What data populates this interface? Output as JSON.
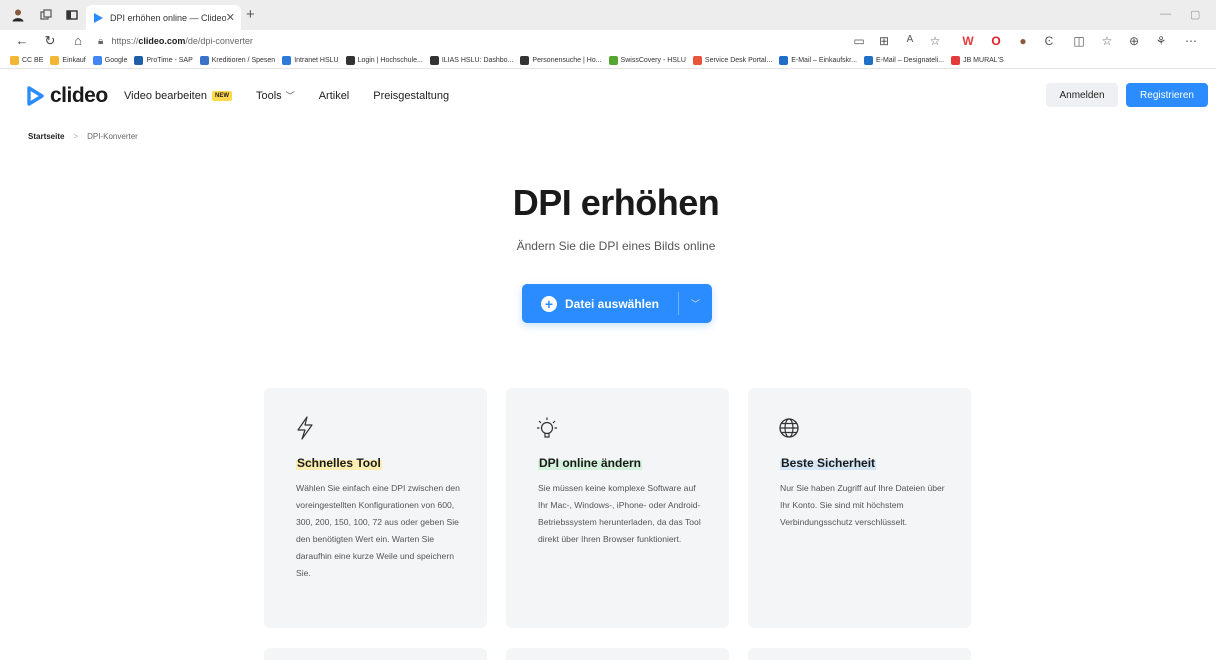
{
  "browser": {
    "tab_title": "DPI erhöhen online — Clideo",
    "url_prefix": "https://",
    "url_domain": "clideo.com",
    "url_path": "/de/dpi-converter",
    "bookmarks": [
      {
        "label": "CC BE",
        "color": "#f2b632"
      },
      {
        "label": "Einkauf",
        "color": "#f2b632"
      },
      {
        "label": "Google",
        "color": "#4285f4"
      },
      {
        "label": "ProTime - SAP",
        "color": "#1e5fa8"
      },
      {
        "label": "Kreditioren / Spesen",
        "color": "#3a72c8"
      },
      {
        "label": "Intranet HSLU",
        "color": "#2f7ad6"
      },
      {
        "label": "Login | Hochschule...",
        "color": "#333333"
      },
      {
        "label": "ILIAS HSLU: Dashbo...",
        "color": "#333333"
      },
      {
        "label": "Personensuche | Ho...",
        "color": "#333333"
      },
      {
        "label": "SwissCovery - HSLU",
        "color": "#55a630"
      },
      {
        "label": "Service Desk Portal...",
        "color": "#e8553a"
      },
      {
        "label": "E-Mail – Einkaufskr...",
        "color": "#1f6fc6"
      },
      {
        "label": "E-Mail – Designateli...",
        "color": "#1f6fc6"
      },
      {
        "label": "JB MURAL'S",
        "color": "#e33b3b"
      }
    ]
  },
  "header": {
    "logo": "clideo",
    "nav": {
      "video": "Video bearbeiten",
      "new_badge": "NEW",
      "tools": "Tools",
      "articles": "Artikel",
      "pricing": "Preisgestaltung"
    },
    "login": "Anmelden",
    "register": "Registrieren"
  },
  "breadcrumb": {
    "home": "Startseite",
    "separator": ">",
    "current": "DPI-Konverter"
  },
  "hero": {
    "title": "DPI erhöhen",
    "subtitle": "Ändern Sie die DPI eines Bilds online",
    "cta": "Datei auswählen"
  },
  "features": [
    {
      "icon": "lightning-icon",
      "title": "Schnelles Tool",
      "text": "Wählen Sie einfach eine DPI zwischen den voreingestellten Konfigurationen von 600, 300, 200, 150, 100, 72 aus oder geben Sie den benötigten Wert ein. Warten Sie daraufhin eine kurze Weile und speichern Sie."
    },
    {
      "icon": "lightbulb-icon",
      "title": "DPI online ändern",
      "text": "Sie müssen keine komplexe Software auf Ihr Mac-, Windows-, iPhone- oder Android-Betriebssystem herunterladen, da das Tool direkt über Ihren Browser funktioniert."
    },
    {
      "icon": "globe-icon",
      "title": "Beste Sicherheit",
      "text": "Nur Sie haben Zugriff auf Ihre Dateien über Ihr Konto. Sie sind mit höchstem Verbindungsschutz verschlüsselt."
    }
  ],
  "colors": {
    "accent": "#2a8cff",
    "card_bg": "#f4f5f7"
  }
}
